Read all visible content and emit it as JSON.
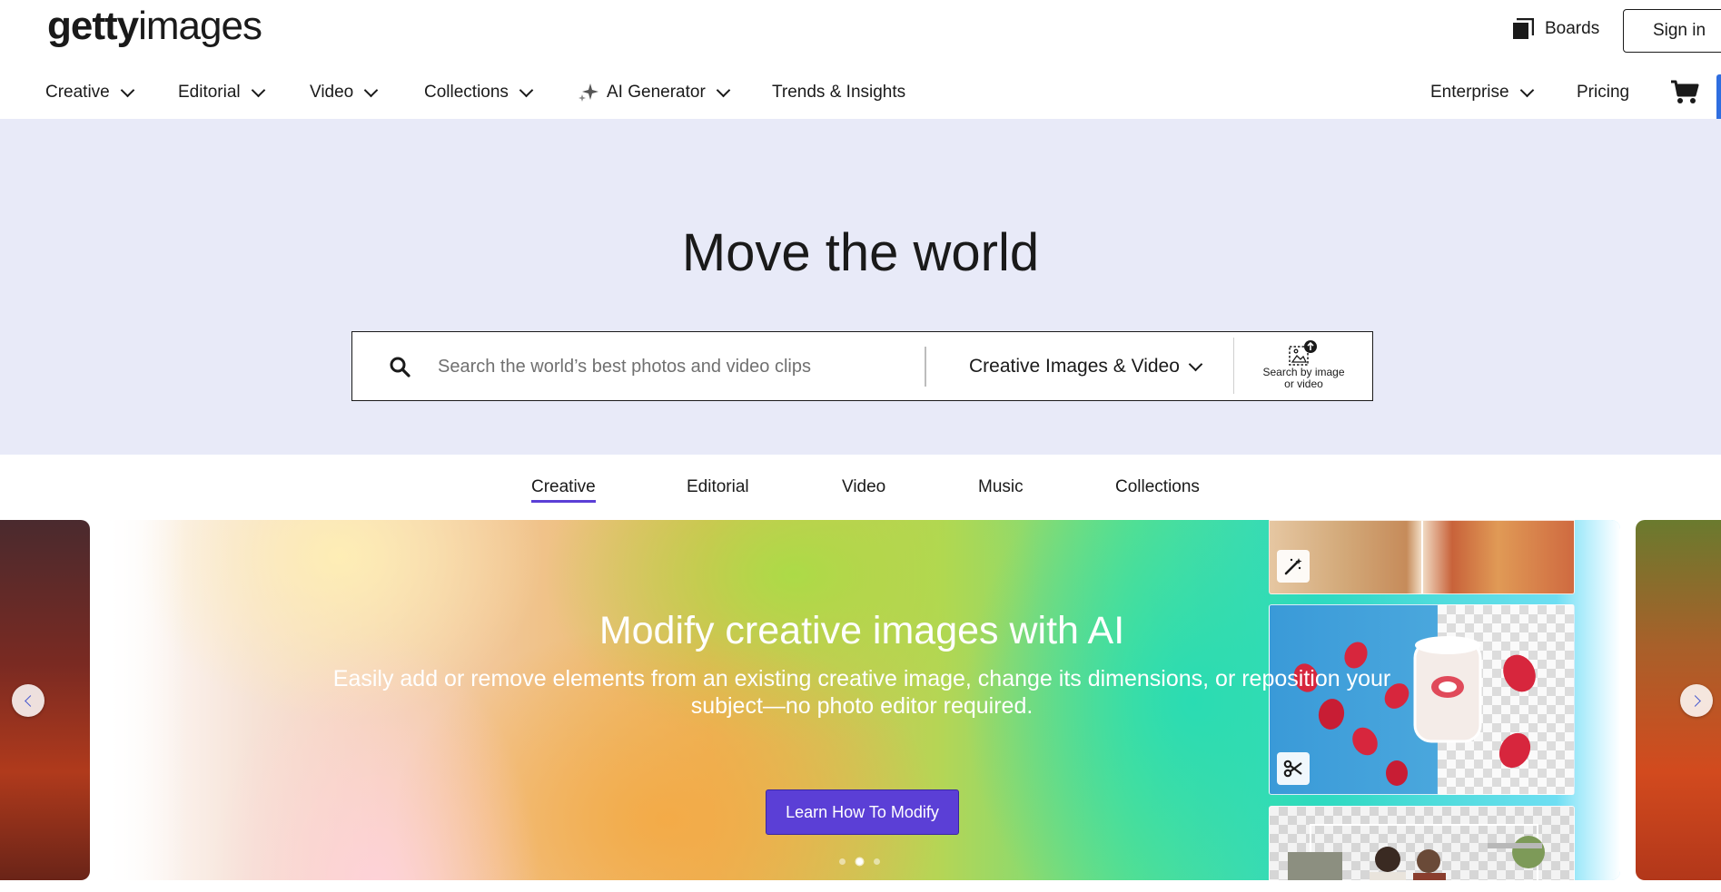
{
  "header": {
    "logo_bold": "getty",
    "logo_light": "images",
    "boards_label": "Boards",
    "signin_label": "Sign in"
  },
  "nav": {
    "items": [
      {
        "label": "Creative",
        "dropdown": true
      },
      {
        "label": "Editorial",
        "dropdown": true
      },
      {
        "label": "Video",
        "dropdown": true
      },
      {
        "label": "Collections",
        "dropdown": true
      },
      {
        "label": "AI Generator",
        "dropdown": true,
        "icon": "sparkle-icon"
      },
      {
        "label": "Trends & Insights",
        "dropdown": false
      }
    ],
    "enterprise_label": "Enterprise",
    "pricing_label": "Pricing",
    "cart_icon": "cart-icon"
  },
  "hero": {
    "title": "Move the world",
    "search_placeholder": "Search the world’s best photos and video clips",
    "search_value": "",
    "search_type": "Creative Images & Video",
    "image_search_label_line1": "Search by image",
    "image_search_label_line2": "or video"
  },
  "tabs": {
    "items": [
      "Creative",
      "Editorial",
      "Video",
      "Music",
      "Collections"
    ],
    "active": "Creative"
  },
  "carousel": {
    "title": "Modify creative images with AI",
    "description": "Easily add or remove elements from an existing creative image, change its dimensions, or reposition your subject—no photo editor required.",
    "cta_label": "Learn How To Modify",
    "slide_count": 3,
    "active_slide": 2
  },
  "colors": {
    "accent": "#5b3fd6",
    "hero_bg": "#e8eaf8",
    "nav_edge": "#2f6ee0"
  }
}
